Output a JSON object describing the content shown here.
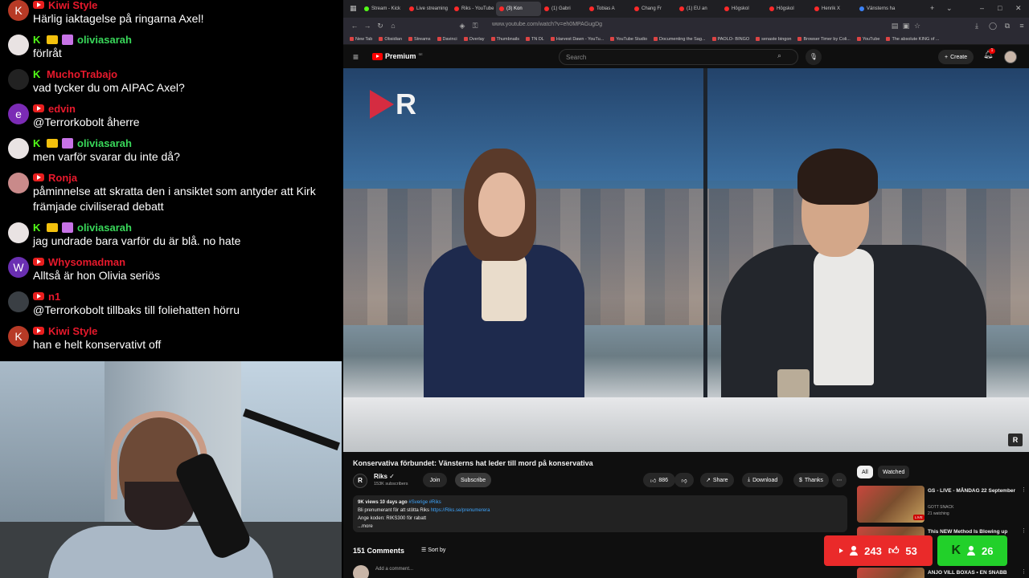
{
  "chat": {
    "messages": [
      {
        "avatar": "K",
        "avatar_color": "#b73a26",
        "platform": "youtube",
        "badges": [],
        "user": "Kiwi Style",
        "user_color": "red",
        "text": "Härlig iaktagelse på ringarna Axel!"
      },
      {
        "avatar": "",
        "avatar_color": "#e9e3e3",
        "platform": "kick",
        "badges": [
          "crown",
          "gift"
        ],
        "user": "oliviasarah",
        "user_color": "green",
        "text": "förlråt"
      },
      {
        "avatar": "",
        "avatar_color": "#222222",
        "platform": "kick",
        "badges": [],
        "user": "MuchoTrabajo",
        "user_color": "red",
        "text": "vad tycker du om AIPAC Axel?"
      },
      {
        "avatar": "e",
        "avatar_color": "#7b2bb5",
        "platform": "youtube",
        "badges": [],
        "user": "edvin",
        "user_color": "red",
        "text": "@Terrorkobolt åherre"
      },
      {
        "avatar": "",
        "avatar_color": "#e9e3e3",
        "platform": "kick",
        "badges": [
          "crown",
          "gift"
        ],
        "user": "oliviasarah",
        "user_color": "green",
        "text": "men varför svarar du inte då?"
      },
      {
        "avatar": "",
        "avatar_color": "#c98a8a",
        "platform": "youtube",
        "badges": [],
        "user": "Ronja",
        "user_color": "red",
        "text": "påminnelse att skratta den i ansiktet som antyder att Kirk främjade civiliserad debatt"
      },
      {
        "avatar": "",
        "avatar_color": "#e9e3e3",
        "platform": "kick",
        "badges": [
          "crown",
          "gift"
        ],
        "user": "oliviasarah",
        "user_color": "green",
        "text": "jag undrade bara varför du är blå. no hate"
      },
      {
        "avatar": "W",
        "avatar_color": "#6a2fb2",
        "platform": "youtube",
        "badges": [],
        "user": "Whysomadman",
        "user_color": "red",
        "text": "Alltså är hon Olivia seriös"
      },
      {
        "avatar": "",
        "avatar_color": "#3a3f44",
        "platform": "youtube",
        "badges": [],
        "user": "n1",
        "user_color": "red",
        "text": "@Terrorkobolt tillbaks till foliehatten hörru"
      },
      {
        "avatar": "K",
        "avatar_color": "#b73a26",
        "platform": "youtube",
        "badges": [],
        "user": "Kiwi Style",
        "user_color": "red",
        "text": "han e helt konservativt off"
      }
    ]
  },
  "browser": {
    "tabs": [
      {
        "label": "Stream - Kick",
        "kind": "kick",
        "active": false
      },
      {
        "label": "Live streaming",
        "kind": "yt",
        "active": false
      },
      {
        "label": "Riks - YouTube",
        "kind": "yt",
        "active": false
      },
      {
        "label": "(3) Kon",
        "kind": "yt",
        "active": true
      },
      {
        "label": "(1) Gabri",
        "kind": "yt",
        "active": false
      },
      {
        "label": "Tobias A",
        "kind": "yt",
        "active": false
      },
      {
        "label": "Chang Fr",
        "kind": "yt",
        "active": false
      },
      {
        "label": "(1) EU an",
        "kind": "yt",
        "active": false
      },
      {
        "label": "Högskol",
        "kind": "yt",
        "active": false
      },
      {
        "label": "Högskol",
        "kind": "yt",
        "active": false
      },
      {
        "label": "Henrik X",
        "kind": "yt",
        "active": false
      },
      {
        "label": "Vänsterns ha",
        "kind": "blue",
        "active": false
      }
    ],
    "url": "www.youtube.com/watch?v=eh0MPAGugDg",
    "bookmarks": [
      "New Tab",
      "Obsidian",
      "Streams",
      "Davinci",
      "Overlay",
      "Thumbnails",
      "TN DL",
      "Harvest Dawn - YouTu...",
      "YouTube Studio",
      "Documenting the Sag...",
      "PAOLO- BINGO",
      "senaste bingon",
      "Browser Timer by Coli...",
      "YouTube",
      "The absolute KING of ..."
    ]
  },
  "youtube": {
    "logo": "Premium",
    "logo_sup": "SE",
    "search_placeholder": "Search",
    "create_label": "Create",
    "notif_count": "1",
    "video_logo": "R",
    "corner_logo": "R",
    "title": "Konservativa förbundet: Vänsterns hat leder till mord på konservativa",
    "channel_name": "Riks",
    "channel_logo": "R",
    "subscribers": "153K subscribers",
    "join": "Join",
    "subscribe": "Subscribe",
    "likes": "886",
    "share": "Share",
    "download": "Download",
    "thanks": "Thanks",
    "desc_meta": "9K views  10 days ago ",
    "desc_tags": "#Sverige #Riks",
    "desc_line1": "Bli prenumerant för att stötta Riks ",
    "desc_link": "https://Riks.se/prenumerera",
    "desc_line2": "Ange koden: RIKS300 för rabatt",
    "desc_more": "...more",
    "comments_count": "151 Comments",
    "sort_label": "Sort by",
    "comment_placeholder": "Add a comment...",
    "chips": [
      "All",
      "Watched"
    ],
    "recommendations": [
      {
        "title": "GS - LIVE - MÅNDAG 22 September",
        "channel": "GOTT SNACK",
        "meta": "21 watching",
        "live": "LIVE"
      },
      {
        "title": "This NEW Method Is Blowing up",
        "channel": "",
        "meta": "",
        "live": ""
      },
      {
        "title": "ANJO VILL BOXAS • EN SNABB",
        "channel": "",
        "meta": "",
        "live": ""
      }
    ]
  },
  "overlay": {
    "youtube_viewers": "243",
    "youtube_likes": "53",
    "kick_viewers": "26"
  }
}
